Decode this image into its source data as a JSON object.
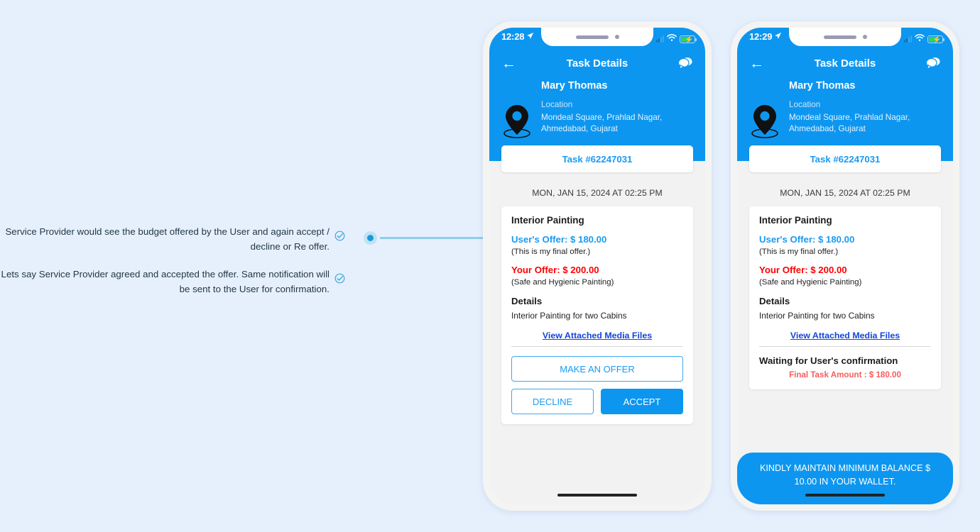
{
  "page": {
    "background_color": "#e6f0fd",
    "accent_blue": "#0d96f0",
    "link_blue": "#1345d8",
    "red": "#ff0000",
    "soft_red": "#f85c5c"
  },
  "annotations": [
    {
      "text": "Service Provider would see the budget offered by the User and again accept / decline or Re offer.",
      "icon": "check-circle-icon"
    },
    {
      "text": "Lets say Service Provider agreed and accepted the offer. Same notification will be sent to the User for confirmation.",
      "icon": "check-circle-icon"
    }
  ],
  "phones": [
    {
      "id": "phone-one",
      "status_bar": {
        "time": "12:28",
        "location_arrow_icon": "location-arrow-icon",
        "signal_icon": "cellular-bars-icon",
        "wifi_icon": "wifi-icon",
        "battery_icon": "battery-charging-icon"
      },
      "nav": {
        "back_icon": "back-arrow-icon",
        "title": "Task Details",
        "chat_icon": "chat-bubbles-icon"
      },
      "header": {
        "customer_name": "Mary Thomas",
        "location_label": "Location",
        "address": "Mondeal Square, Prahlad Nagar,\nAhmedabad, Gujarat",
        "pin_icon": "map-pin-icon"
      },
      "task_id": "Task #62247031",
      "datetime": "MON, JAN 15, 2024 AT 02:25 PM",
      "card": {
        "title": "Interior Painting",
        "users_offer": "User's Offer: $ 180.00",
        "users_offer_note": "(This is my final offer.)",
        "your_offer": "Your Offer: $ 200.00",
        "your_offer_note": "(Safe and Hygienic Painting)",
        "details_heading": "Details",
        "details_body": "Interior Painting for two Cabins",
        "media_link": "View Attached Media Files"
      },
      "actions": {
        "make_offer": "MAKE AN OFFER",
        "decline": "DECLINE",
        "accept": "ACCEPT"
      }
    },
    {
      "id": "phone-two",
      "status_bar": {
        "time": "12:29",
        "location_arrow_icon": "location-arrow-icon",
        "signal_icon": "cellular-bars-icon",
        "wifi_icon": "wifi-icon",
        "battery_icon": "battery-charging-icon"
      },
      "nav": {
        "back_icon": "back-arrow-icon",
        "title": "Task Details",
        "chat_icon": "chat-bubbles-icon"
      },
      "header": {
        "customer_name": "Mary Thomas",
        "location_label": "Location",
        "address": "Mondeal Square, Prahlad Nagar,\nAhmedabad, Gujarat",
        "pin_icon": "map-pin-icon"
      },
      "task_id": "Task #62247031",
      "datetime": "MON, JAN 15, 2024 AT 02:25 PM",
      "card": {
        "title": "Interior Painting",
        "users_offer": "User's Offer: $ 180.00",
        "users_offer_note": "(This is my final offer.)",
        "your_offer": "Your Offer: $ 200.00",
        "your_offer_note": "(Safe and Hygienic Painting)",
        "details_heading": "Details",
        "details_body": "Interior Painting for two Cabins",
        "media_link": "View Attached Media Files"
      },
      "status": {
        "waiting_text": "Waiting for User's confirmation",
        "final_amount": "Final Task Amount : $ 180.00"
      },
      "wallet_banner": "KINDLY MAINTAIN MINIMUM BALANCE $ 10.00 IN YOUR WALLET."
    }
  ]
}
